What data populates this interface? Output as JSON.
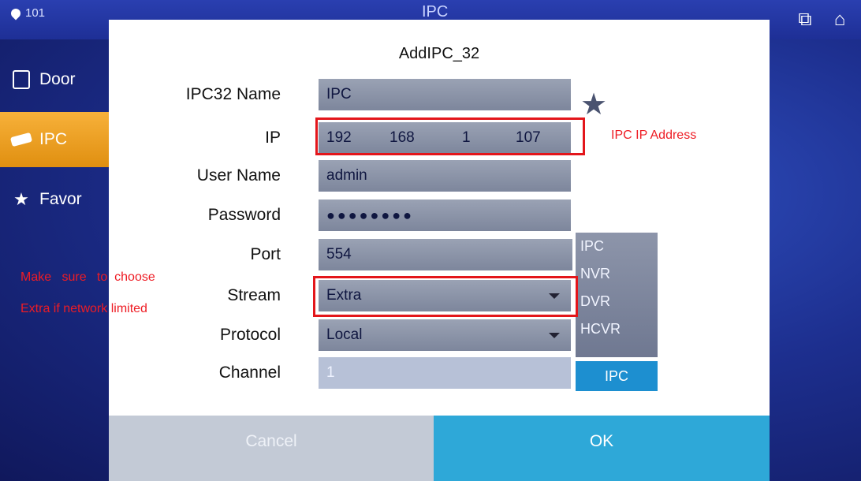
{
  "screen": {
    "room_number": "101",
    "title": "IPC",
    "top_icons": [
      "window-switch-icon",
      "home-icon"
    ]
  },
  "menu": {
    "items": [
      {
        "label": "Door",
        "icon": "door-icon",
        "active": false
      },
      {
        "label": "IPC",
        "icon": "camera-icon",
        "active": true
      },
      {
        "label": "Favor",
        "icon": "star-icon",
        "active": false
      }
    ]
  },
  "dialog": {
    "title": "AddIPC_32",
    "fields": {
      "name": {
        "label": "IPC32 Name",
        "value": "IPC"
      },
      "ip": {
        "label": "IP",
        "octets": [
          "192",
          "168",
          "1",
          "107"
        ]
      },
      "username": {
        "label": "User Name",
        "value": "admin"
      },
      "password": {
        "label": "Password",
        "value": "●●●●●●●●"
      },
      "port": {
        "label": "Port",
        "value": "554"
      },
      "stream": {
        "label": "Stream",
        "value": "Extra"
      },
      "protocol": {
        "label": "Protocol",
        "value": "Local"
      },
      "channel": {
        "label": "Channel",
        "value": "1"
      }
    },
    "device_types": [
      "IPC",
      "NVR",
      "DVR",
      "HCVR"
    ],
    "selected_device_type": "IPC",
    "buttons": {
      "cancel": "Cancel",
      "ok": "OK"
    }
  },
  "annotations": {
    "ip_note": "IPC IP Address",
    "stream_note_line1": "Make   sure   to  choose",
    "stream_note_line2": "Extra if network limited",
    "color": "#e3161b"
  }
}
